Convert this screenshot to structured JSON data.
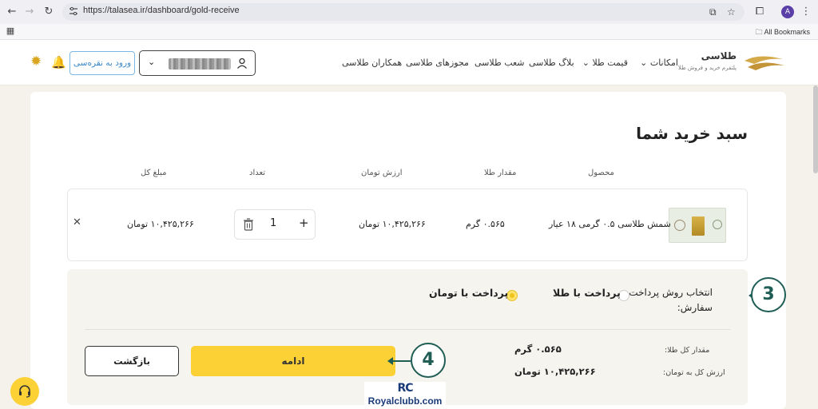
{
  "browser": {
    "url": "https://talasea.ir/dashboard/gold-receive",
    "bookmarks_label": "All Bookmarks",
    "profile_initial": "A"
  },
  "header": {
    "logo_title": "طلاسی",
    "logo_subtitle": "پلتفرم خرید و فروش طلا",
    "nav": [
      "امکانات",
      "قیمت طلا",
      "بلاگ طلاسی",
      "شعب طلاسی",
      "مجوزهای طلاسی",
      "همکاران طلاسی"
    ],
    "login_button": "ورود به نقره‌سی"
  },
  "cart": {
    "title": "سبد خرید شما",
    "columns": {
      "product": "محصول",
      "gold_amount": "مقدار طلا",
      "toman_value": "ارزش تومان",
      "quantity": "تعداد",
      "total": "مبلغ کل"
    },
    "item": {
      "name": "شمش طلاسی ۰.۵ گرمی ۱۸ عیار",
      "gold_amount": "۰.۵۶۵ گرم",
      "toman_value": "۱۰,۴۲۵,۲۶۶ تومان",
      "quantity": "1",
      "total": "۱۰,۴۲۵,۲۶۶ تومان"
    }
  },
  "payment": {
    "title": "انتخاب روش پرداخت سفارش:",
    "option_gold": "پرداخت با طلا",
    "option_toman": "پرداخت با تومان",
    "selected": "toman",
    "total_gold_label": "مقدار کل طلا:",
    "total_gold_value": "۰.۵۶۵ گرم",
    "total_toman_label": "ارزش کل به تومان:",
    "total_toman_value": "۱۰,۴۲۵,۲۶۶ تومان",
    "continue_button": "ادامه",
    "back_button": "بازگشت"
  },
  "annotations": {
    "step3": "3",
    "step4": "4",
    "color": "#1f5d55"
  },
  "watermark": {
    "logo": "RC",
    "text": "Royalclubb.com"
  },
  "colors": {
    "accent": "#fcd136",
    "login_border": "#7ab7e6"
  }
}
